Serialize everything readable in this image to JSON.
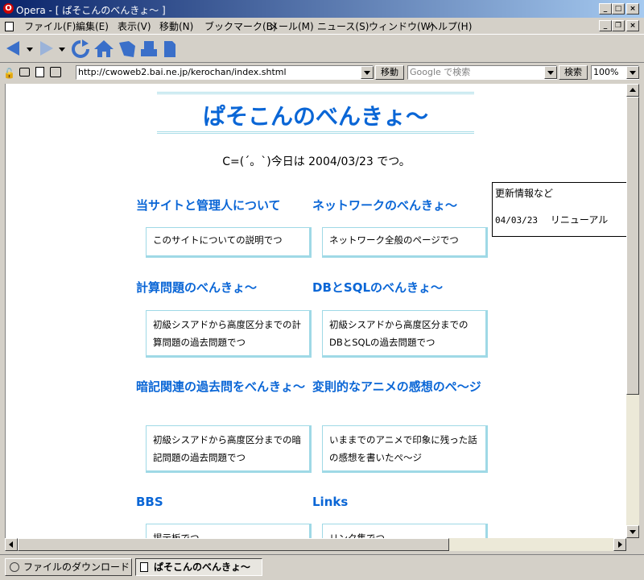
{
  "window": {
    "title": "Opera - [ ぱそこんのべんきょ～ ]",
    "controls": [
      "_",
      "□",
      "×"
    ]
  },
  "menu": [
    "ファイル(F)",
    "編集(E)",
    "表示(V)",
    "移動(N)",
    "ブックマーク(B)",
    "メール(M)",
    "ニュース(S)",
    "ウィンドウ(W)",
    "ヘルプ(H)"
  ],
  "address": {
    "url": "http://cwoweb2.bai.ne.jp/kerochan/index.shtml",
    "go_label": "移動",
    "search_placeholder": "Google で検索",
    "search_label": "検索",
    "zoom": "100%"
  },
  "page": {
    "title": "ぱそこんのべんきょ～",
    "date_line": "C=(´。`)今日は 2004/03/23 でつ。",
    "sections": [
      {
        "title": "当サイトと管理人について",
        "desc": "このサイトについての説明でつ"
      },
      {
        "title": "ネットワークのべんきょ～",
        "desc": "ネットワーク全般のページでつ"
      },
      {
        "title": "計算問題のべんきょ～",
        "desc": "初級シスアドから高度区分までの計算問題の過去問題でつ"
      },
      {
        "title": "DBとSQLのべんきょ～",
        "desc": "初級シスアドから高度区分までのDBとSQLの過去問題でつ"
      },
      {
        "title": "暗記関連の過去問をべんきょ～",
        "desc": "初級シスアドから高度区分までの暗記問題の過去問題でつ"
      },
      {
        "title": "変則的なアニメの感想のぺ～ジ",
        "desc": "いままでのアニメで印象に残った話の感想を書いたぺ～ジ"
      },
      {
        "title": "BBS",
        "desc": "掲示板でつ"
      },
      {
        "title": "Links",
        "desc": "リンク集でつ"
      }
    ],
    "news": {
      "heading": "更新情報など",
      "date": "04/03/23",
      "text": "リニューアル"
    }
  },
  "tabs": {
    "download": "ファイルのダウンロード",
    "active": "ぱそこんのべんきょ～"
  },
  "colors": {
    "accent": "#0a66d6",
    "border": "#9fd9e6",
    "titlebar": "#0a246a"
  }
}
